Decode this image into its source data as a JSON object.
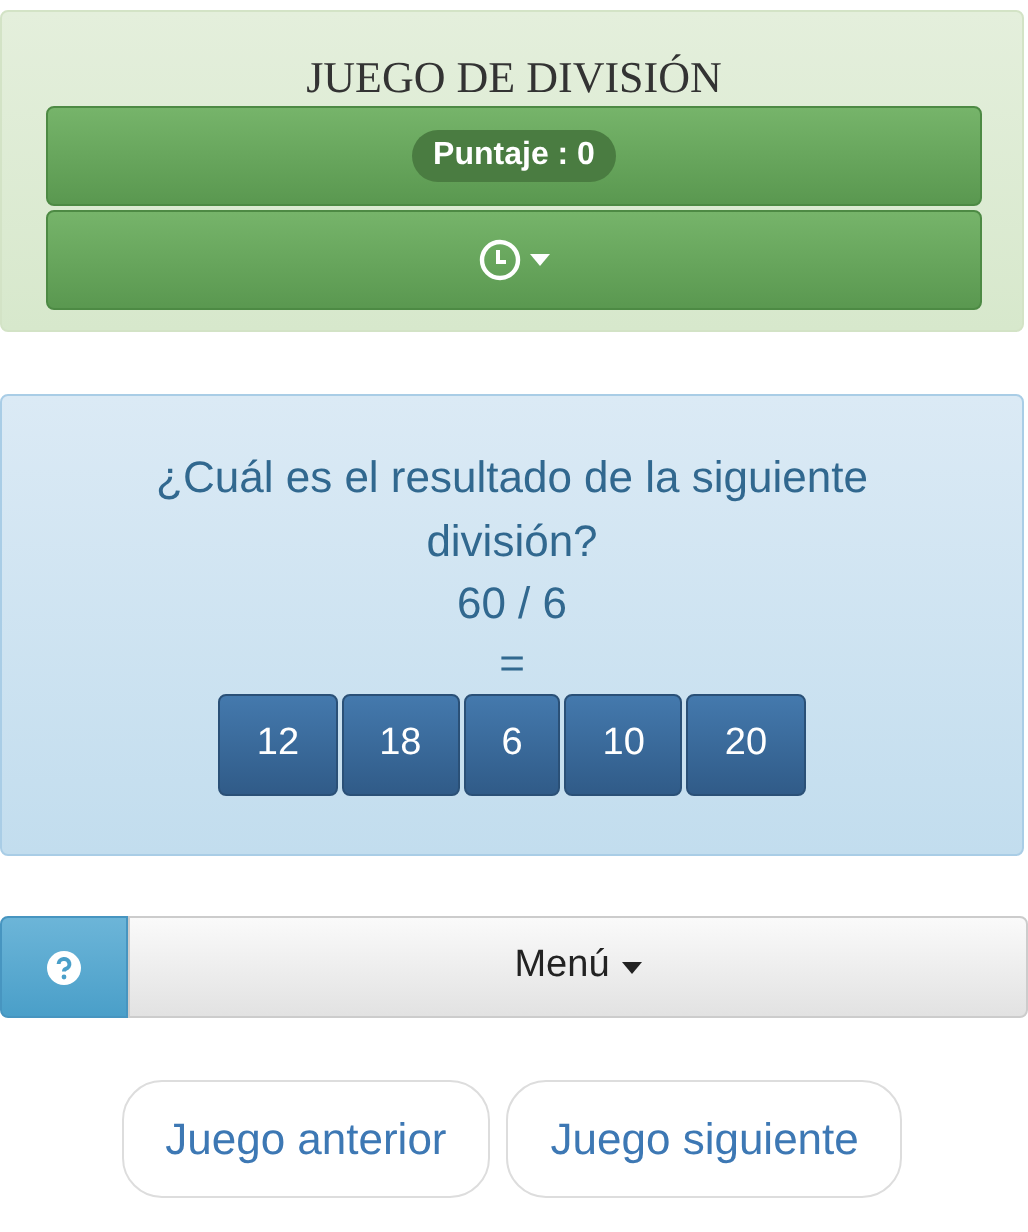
{
  "title": "JUEGO DE DIVISIÓN",
  "score": "Puntaje : 0",
  "question": "¿Cuál es el resultado de la siguiente división?",
  "operation": "60 / 6",
  "equals": "=",
  "answers": [
    "12",
    "18",
    "6",
    "10",
    "20"
  ],
  "menu": "Menú",
  "nav": [
    "Juego anterior",
    "Juego siguiente"
  ]
}
